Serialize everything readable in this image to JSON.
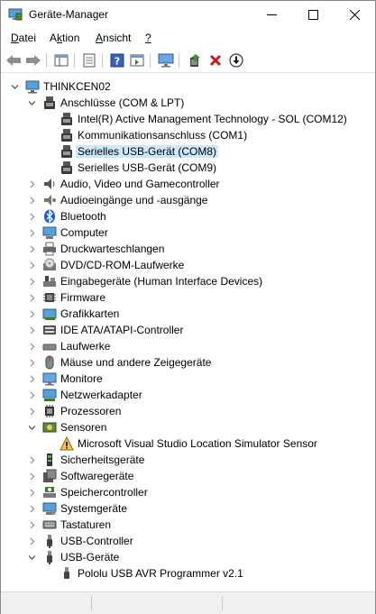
{
  "window": {
    "title": "Geräte-Manager"
  },
  "menu": [
    {
      "label": "Datei",
      "mnemonic_index": 0
    },
    {
      "label": "Aktion",
      "mnemonic_index": 1
    },
    {
      "label": "Ansicht",
      "mnemonic_index": 0
    },
    {
      "label": "?",
      "mnemonic_index": 0
    }
  ],
  "tree": {
    "root": "THINKCEN02",
    "ports": {
      "label": "Anschlüsse (COM & LPT)",
      "children": [
        "Intel(R) Active Management Technology - SOL (COM12)",
        "Kommunikationsanschluss (COM1)",
        "Serielles USB-Gerät (COM8)",
        "Serielles USB-Gerät (COM9)"
      ],
      "selected_index": 2
    },
    "cat_a": [
      "Audio, Video und Gamecontroller",
      "Audioeingänge und -ausgänge",
      "Bluetooth",
      "Computer",
      "Druckwarteschlangen",
      "DVD/CD-ROM-Laufwerke",
      "Eingabegeräte (Human Interface Devices)",
      "Firmware",
      "Grafikkarten",
      "IDE ATA/ATAPI-Controller",
      "Laufwerke",
      "Mäuse und andere Zeigegeräte",
      "Monitore",
      "Netzwerkadapter",
      "Prozessoren"
    ],
    "sensors": {
      "label": "Sensoren",
      "children": [
        "Microsoft Visual Studio Location Simulator Sensor"
      ]
    },
    "cat_b": [
      "Sicherheitsgeräte",
      "Softwaregeräte",
      "Speichercontroller",
      "Systemgeräte",
      "Tastaturen",
      "USB-Controller"
    ],
    "usb": {
      "label": "USB-Geräte",
      "children": [
        "Pololu USB AVR Programmer v2.1"
      ]
    }
  }
}
